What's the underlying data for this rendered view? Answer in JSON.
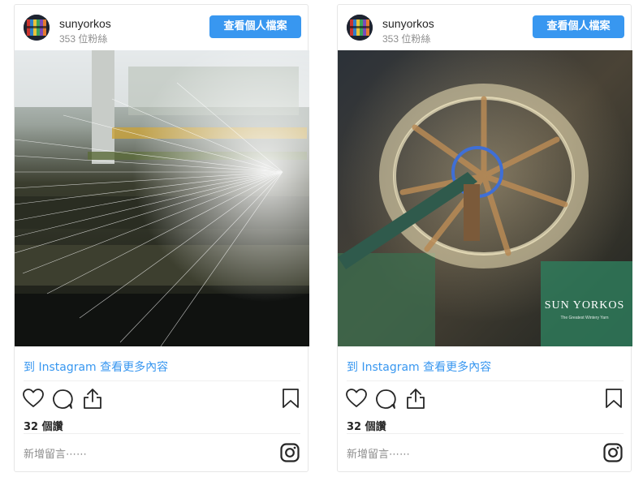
{
  "posts": [
    {
      "username": "sunyorkos",
      "followers": "353 位粉絲",
      "view_profile_label": "查看個人檔案",
      "more_link": "到 Instagram 查看更多內容",
      "likes": "32 個讚",
      "add_comment_placeholder": "新增留言⋯⋯",
      "photo_description": "textile loom threads in factory"
    },
    {
      "username": "sunyorkos",
      "followers": "353 位粉絲",
      "view_profile_label": "查看個人檔案",
      "more_link": "到 Instagram 查看更多內容",
      "likes": "32 個讚",
      "add_comment_placeholder": "新增留言⋯⋯",
      "photo_watermark_title": "SUN YORKOS",
      "photo_watermark_subtitle": "The Greatest Wintery Yarn"
    }
  ],
  "colors": {
    "accent": "#3897f0",
    "text": "#262626",
    "muted": "#8e8e8e",
    "border": "#e6e6e6"
  },
  "icons": [
    "heart-icon",
    "comment-icon",
    "share-icon",
    "bookmark-icon",
    "instagram-icon"
  ]
}
